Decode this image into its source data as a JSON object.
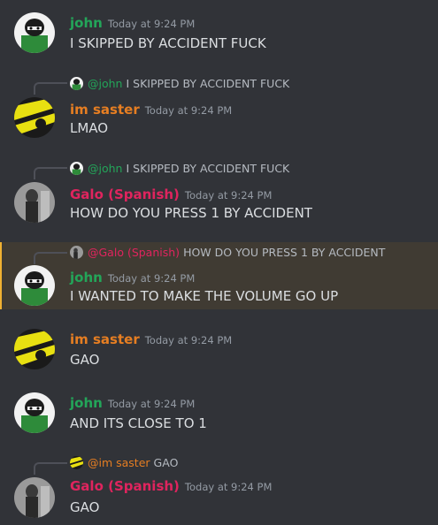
{
  "colors": {
    "background": "#313338",
    "highlight": "#403b33",
    "highlight_bar": "#f0b132",
    "john": "#23a559",
    "saster": "#e67e22",
    "galo": "#e0245e"
  },
  "messages": [
    {
      "author": "john",
      "timestamp": "Today at 9:24 PM",
      "text": "I SKIPPED BY ACCIDENT FUCK"
    },
    {
      "reply": {
        "mention": "@john",
        "text": "I SKIPPED BY ACCIDENT FUCK"
      },
      "author": "im saster",
      "timestamp": "Today at 9:24 PM",
      "text": "LMAO"
    },
    {
      "reply": {
        "mention": "@john",
        "text": "I SKIPPED BY ACCIDENT FUCK"
      },
      "author": "Galo (Spanish)",
      "timestamp": "Today at 9:24 PM",
      "text": "HOW DO YOU PRESS 1 BY ACCIDENT"
    },
    {
      "reply": {
        "mention": "@Galo (Spanish)",
        "text": "HOW DO YOU PRESS 1 BY ACCIDENT"
      },
      "author": "john",
      "timestamp": "Today at 9:24 PM",
      "text": "I WANTED TO MAKE THE VOLUME GO UP"
    },
    {
      "author": "im saster",
      "timestamp": "Today at 9:24 PM",
      "text": "GAO"
    },
    {
      "author": "john",
      "timestamp": "Today at 9:24 PM",
      "text": "AND ITS CLOSE TO 1"
    },
    {
      "reply": {
        "mention": "@im saster",
        "text": "GAO"
      },
      "author": "Galo (Spanish)",
      "timestamp": "Today at 9:24 PM",
      "text": "GAO"
    }
  ]
}
